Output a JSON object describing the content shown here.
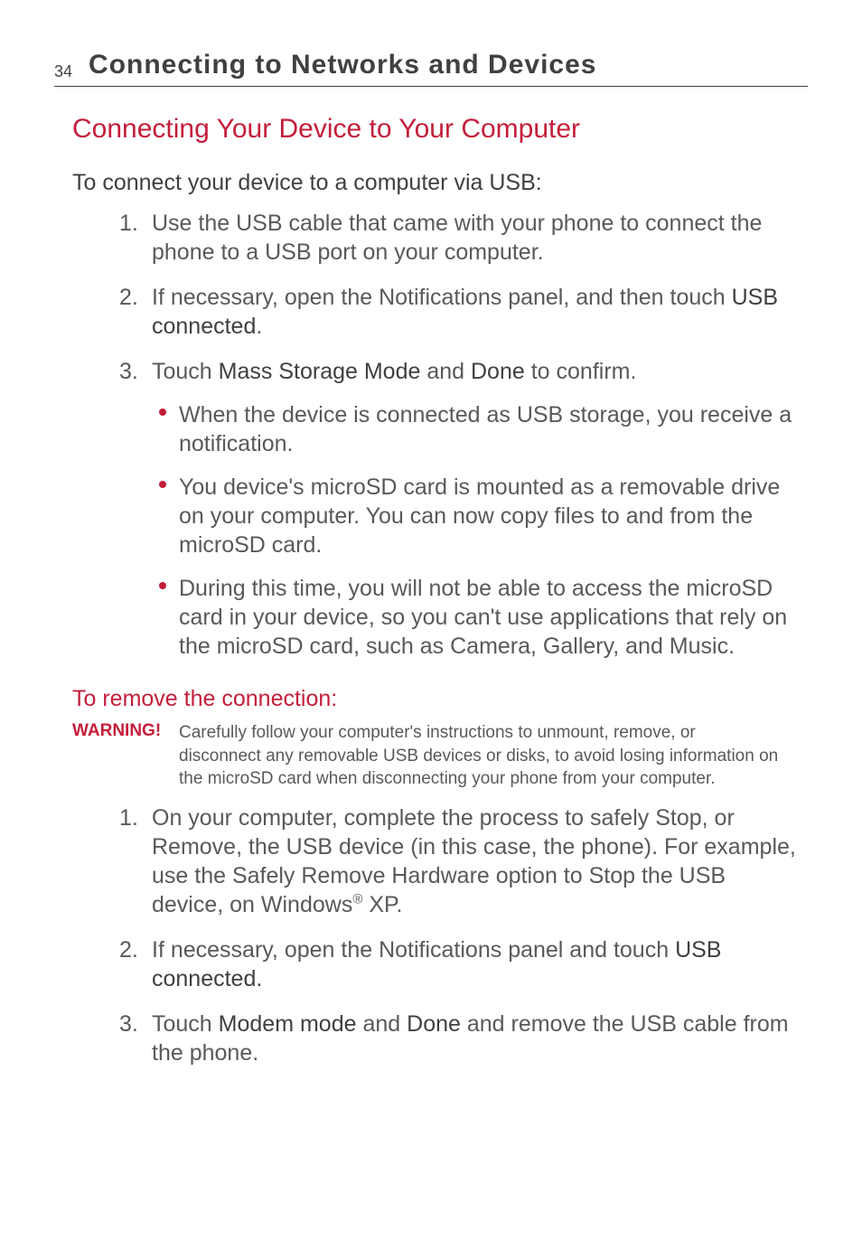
{
  "header": {
    "page_number": "34",
    "chapter_title": "Connecting to Networks and Devices"
  },
  "section_title": "Connecting Your Device to Your Computer",
  "subsection1": {
    "title": "To connect your device to a computer via USB:",
    "items": [
      {
        "num": "1.",
        "text_before": "Use the USB cable that came with your phone to connect the phone to a USB port on your computer."
      },
      {
        "num": "2.",
        "text_before": "If necessary, open the Notifications panel, and then touch ",
        "bold1": "USB connected",
        "text_after1": "."
      },
      {
        "num": "3.",
        "text_before": "Touch ",
        "bold1": "Mass Storage Mode",
        "mid1": " and ",
        "bold2": "Done",
        "text_after1": " to confirm."
      }
    ],
    "bullets": [
      "When the device is connected as USB storage, you receive a notification.",
      "You device's microSD card is mounted as a removable drive on your computer. You can now copy files to and from the microSD card.",
      "During this time, you will not be able to access the microSD card in your device, so you can't use applications that rely on the microSD card, such as Camera, Gallery, and Music."
    ]
  },
  "subsection2": {
    "title": "To remove the connection:",
    "warning_label": "WARNING!",
    "warning_text": "Carefully follow your computer's instructions to unmount, remove, or disconnect any removable USB devices or disks, to avoid losing information on the microSD card when disconnecting your phone from your computer.",
    "items": [
      {
        "num": "1.",
        "text_before": "On your computer, complete the process to safely Stop, or Remove, the USB device (in this case, the phone). For example, use the Safely Remove Hardware option to Stop the USB device, on Windows",
        "sup": "®",
        "text_after_sup": " XP."
      },
      {
        "num": "2.",
        "text_before": "If necessary, open the Notifications panel and touch ",
        "bold1": "USB connected.",
        "text_after1": ""
      },
      {
        "num": "3.",
        "text_before": "Touch ",
        "bold1": "Modem mode",
        "mid1": " and ",
        "bold2": "Done",
        "text_after1": " and remove the USB cable from the phone."
      }
    ]
  }
}
